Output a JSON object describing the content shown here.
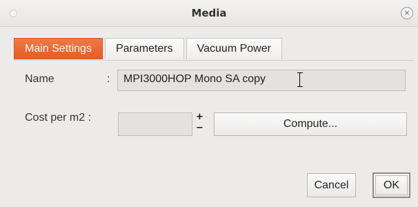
{
  "window": {
    "title": "Media",
    "close_symbol": "×",
    "icons": [
      "close-icon"
    ]
  },
  "tabs": [
    {
      "label": "Main Settings",
      "active": true
    },
    {
      "label": "Parameters",
      "active": false
    },
    {
      "label": "Vacuum Power",
      "active": false
    }
  ],
  "form": {
    "name_label": "Name",
    "name_separator": ":",
    "name_value": "MPI3000HOP Mono SA copy",
    "cost_label": "Cost per m2  :",
    "cost_value": "",
    "spin_up": "+",
    "spin_down": "−",
    "compute_label": "Compute..."
  },
  "footer": {
    "cancel_label": "Cancel",
    "ok_label": "OK"
  },
  "colors": {
    "active_tab": "#e55a22",
    "background": "#ecebe9"
  }
}
